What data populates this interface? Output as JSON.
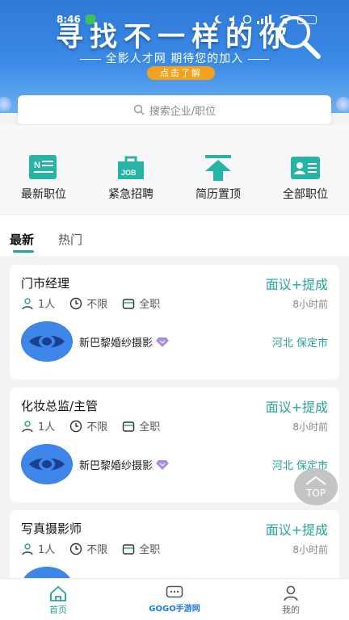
{
  "status_bar": {
    "time": "8:46"
  },
  "banner": {
    "slogan": "寻找不一样的你",
    "subtitle": "全影人才网  期待您的加入",
    "cta": "点击了解"
  },
  "search": {
    "placeholder": "搜索企业/职位"
  },
  "categories": [
    {
      "label": "最新职位",
      "icon": "new-jobs-icon"
    },
    {
      "label": "紧急招聘",
      "icon": "urgent-job-icon"
    },
    {
      "label": "简历置顶",
      "icon": "pin-top-icon"
    },
    {
      "label": "全部职位",
      "icon": "id-card-icon"
    }
  ],
  "tabs": [
    {
      "label": "最新"
    },
    {
      "label": "热门"
    }
  ],
  "jobs": [
    {
      "title": "门市经理",
      "salary": "面议+提成",
      "count": "1人",
      "experience": "不限",
      "type": "全职",
      "time": "8小时前",
      "company": "新巴黎婚纱摄影",
      "location": "河北 保定市"
    },
    {
      "title": "化妆总监/主管",
      "salary": "面议+提成",
      "count": "1人",
      "experience": "不限",
      "type": "全职",
      "time": "8小时前",
      "company": "新巴黎婚纱摄影",
      "location": "河北 保定市"
    },
    {
      "title": "写真摄影师",
      "salary": "面议+提成",
      "count": "1人",
      "experience": "不限",
      "type": "全职",
      "time": "8小时前"
    }
  ],
  "top_button": {
    "label": "TOP"
  },
  "bottom_nav": {
    "items": [
      {
        "label": "首页",
        "icon": "home-icon"
      },
      {
        "label": "",
        "icon": "message-icon"
      },
      {
        "label": "我的",
        "icon": "user-icon"
      }
    ],
    "watermark": "GOGO手游网"
  },
  "colors": {
    "accent": "#27a39a",
    "banner": "#3a8ae6",
    "cta": "#f4a11d",
    "logo": "#3f86ea"
  }
}
